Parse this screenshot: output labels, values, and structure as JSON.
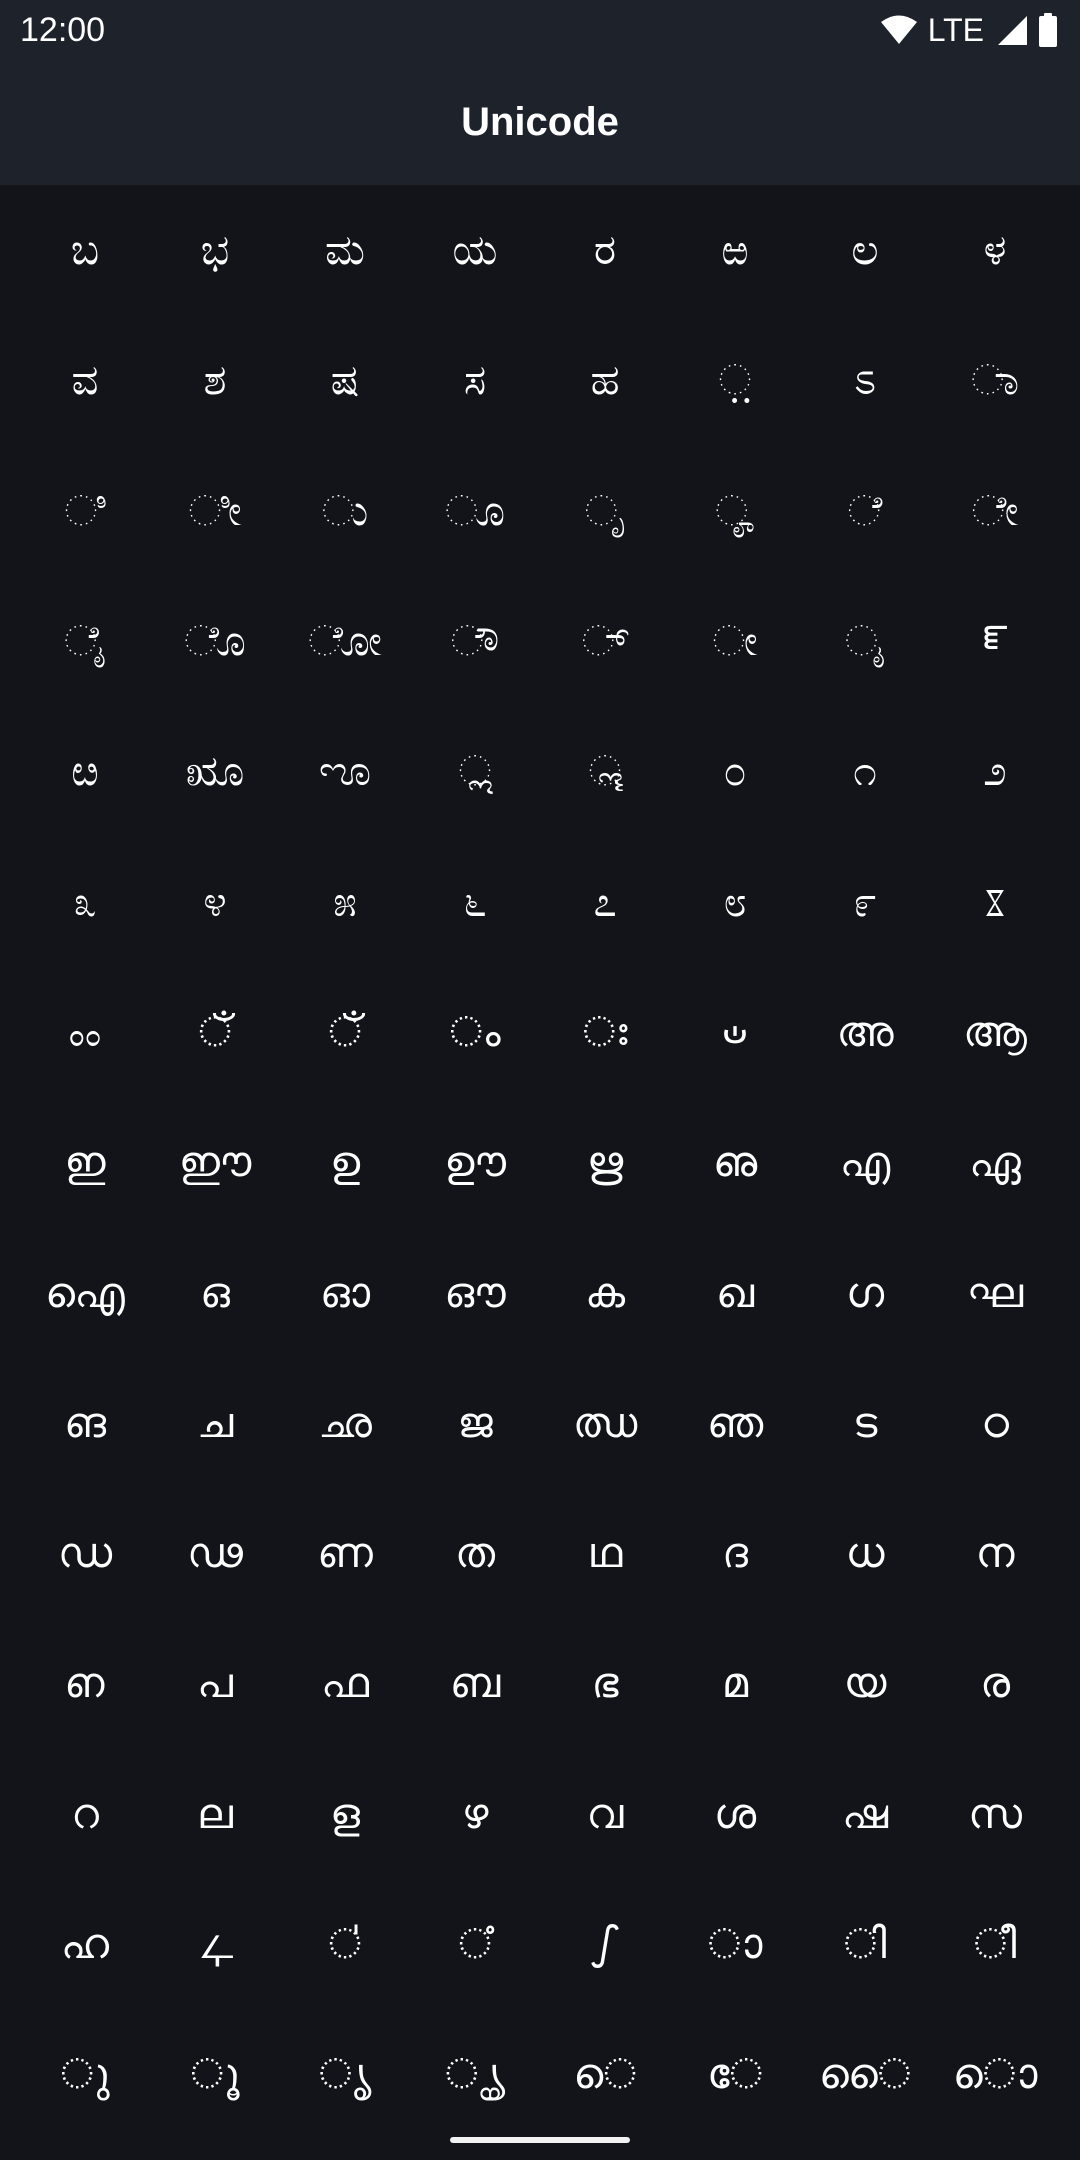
{
  "status_bar": {
    "time": "12:00",
    "network": "LTE",
    "icons": [
      "wifi-icon",
      "cell-signal-icon",
      "battery-icon"
    ]
  },
  "app_bar": {
    "title": "Unicode"
  },
  "glyphs": [
    "ಬ",
    "ಭ",
    "ಮ",
    "ಯ",
    "ರ",
    "ಱ",
    "ಲ",
    "ಳ",
    "ವ",
    "ಶ",
    "ಷ",
    "ಸ",
    "ಹ",
    "಼",
    "ಽ",
    "ಾ",
    "ಿ",
    "ೀ",
    "ು",
    "ೂ",
    "ೃ",
    "ೄ",
    "ೆ",
    "ೇ",
    "ೈ",
    "ೊ",
    "ೋ",
    "ೌ",
    "್",
    "ೕ",
    "ೖ",
    "ೝ",
    "ೞ",
    "ೠ",
    "ೡ",
    "ೢ",
    "ೣ",
    "೦",
    "೧",
    "೨",
    "೩",
    "೪",
    "೫",
    "೬",
    "೭",
    "೮",
    "೯",
    "ೱ",
    "ೲ",
    "ഁ",
    "ഁ",
    "ം",
    "ഃ",
    "ഄ",
    "അ",
    "ആ",
    "ഇ",
    "ഈ",
    "ഉ",
    "ഊ",
    "ഋ",
    "ഌ",
    "എ",
    "ഏ",
    "ഐ",
    "ഒ",
    "ഓ",
    "ഔ",
    "ക",
    "ഖ",
    "ഗ",
    "ഘ",
    "ങ",
    "ച",
    "ഛ",
    "ജ",
    "ഝ",
    "ഞ",
    "ട",
    "ഠ",
    "ഡ",
    "ഢ",
    "ണ",
    "ത",
    "ഥ",
    "ദ",
    "ധ",
    "ന",
    "ഩ",
    "പ",
    "ഫ",
    "ബ",
    "ഭ",
    "മ",
    "യ",
    "ര",
    "റ",
    "ല",
    "ള",
    "ഴ",
    "വ",
    "ശ",
    "ഷ",
    "സ",
    "ഹ",
    "ഺ",
    "഻",
    "഼",
    "ഽ",
    "ാ",
    "ി",
    "ീ",
    "ു",
    "ൂ",
    "ൃ",
    "ൄ",
    "െ",
    "േ",
    "ൈ",
    "ൊ"
  ]
}
